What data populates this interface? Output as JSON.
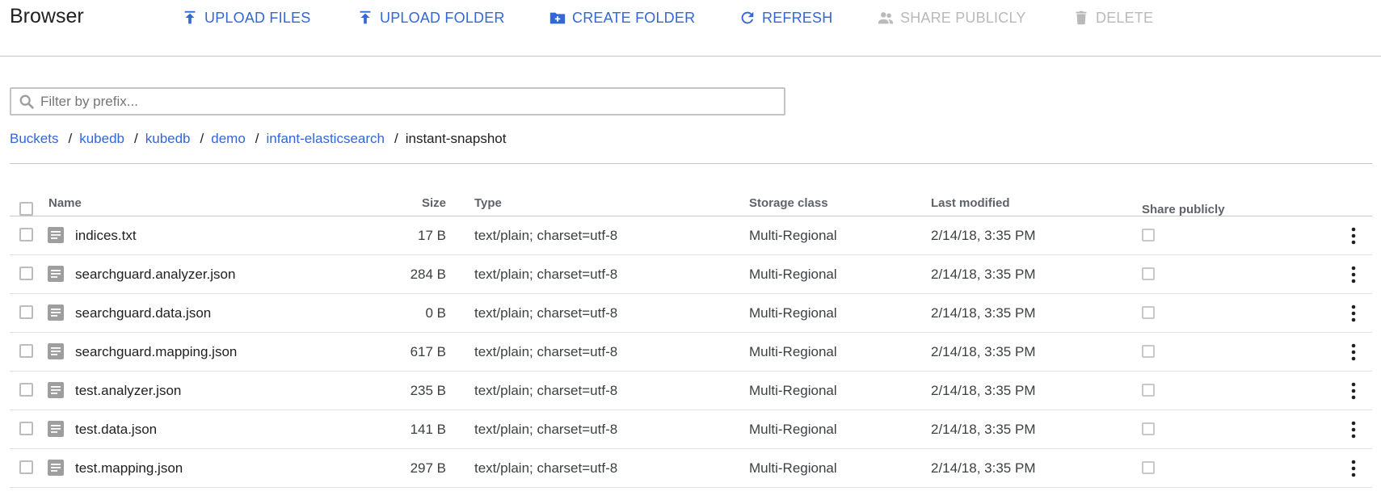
{
  "header": {
    "title": "Browser",
    "actions": [
      {
        "label": "UPLOAD FILES",
        "icon": "upload-icon",
        "enabled": true
      },
      {
        "label": "UPLOAD FOLDER",
        "icon": "upload-icon",
        "enabled": true
      },
      {
        "label": "CREATE FOLDER",
        "icon": "folder-add-icon",
        "enabled": true
      },
      {
        "label": "REFRESH",
        "icon": "refresh-icon",
        "enabled": true
      },
      {
        "label": "SHARE PUBLICLY",
        "icon": "people-icon",
        "enabled": false
      },
      {
        "label": "DELETE",
        "icon": "trash-icon",
        "enabled": false
      }
    ]
  },
  "filter": {
    "placeholder": "Filter by prefix...",
    "value": ""
  },
  "breadcrumb": {
    "links": [
      "Buckets",
      "kubedb",
      "kubedb",
      "demo",
      "infant-elasticsearch"
    ],
    "separator": "/",
    "current": "instant-snapshot"
  },
  "table": {
    "columns": {
      "name": "Name",
      "size": "Size",
      "type": "Type",
      "storage_class": "Storage class",
      "last_modified": "Last modified",
      "share_publicly": "Share publicly"
    },
    "rows": [
      {
        "name": "indices.txt",
        "size": "17 B",
        "type": "text/plain; charset=utf-8",
        "storage_class": "Multi-Regional",
        "last_modified": "2/14/18, 3:35 PM"
      },
      {
        "name": "searchguard.analyzer.json",
        "size": "284 B",
        "type": "text/plain; charset=utf-8",
        "storage_class": "Multi-Regional",
        "last_modified": "2/14/18, 3:35 PM"
      },
      {
        "name": "searchguard.data.json",
        "size": "0 B",
        "type": "text/plain; charset=utf-8",
        "storage_class": "Multi-Regional",
        "last_modified": "2/14/18, 3:35 PM"
      },
      {
        "name": "searchguard.mapping.json",
        "size": "617 B",
        "type": "text/plain; charset=utf-8",
        "storage_class": "Multi-Regional",
        "last_modified": "2/14/18, 3:35 PM"
      },
      {
        "name": "test.analyzer.json",
        "size": "235 B",
        "type": "text/plain; charset=utf-8",
        "storage_class": "Multi-Regional",
        "last_modified": "2/14/18, 3:35 PM"
      },
      {
        "name": "test.data.json",
        "size": "141 B",
        "type": "text/plain; charset=utf-8",
        "storage_class": "Multi-Regional",
        "last_modified": "2/14/18, 3:35 PM"
      },
      {
        "name": "test.mapping.json",
        "size": "297 B",
        "type": "text/plain; charset=utf-8",
        "storage_class": "Multi-Regional",
        "last_modified": "2/14/18, 3:35 PM"
      }
    ]
  },
  "colors": {
    "accent": "#3367d6",
    "disabled": "#b9b9b9",
    "file_icon": "#9e9e9e"
  }
}
